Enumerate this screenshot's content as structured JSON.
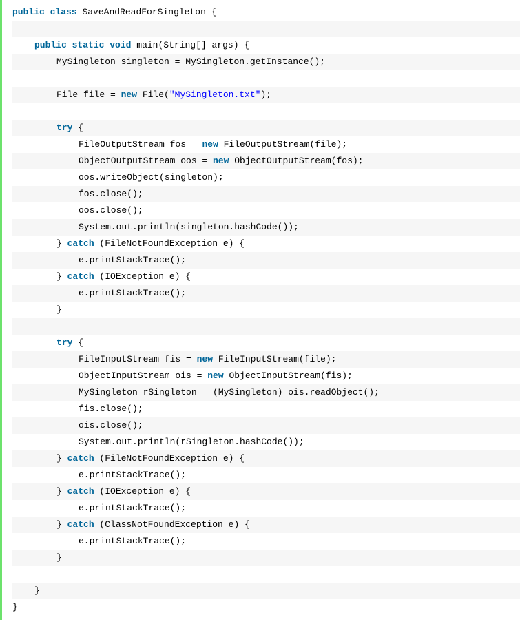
{
  "code": {
    "lines": [
      {
        "indent": 0,
        "spans": [
          {
            "t": "public",
            "c": "kw"
          },
          {
            "t": " ",
            "c": "plain"
          },
          {
            "t": "class",
            "c": "kw"
          },
          {
            "t": " SaveAndReadForSingleton {",
            "c": "plain"
          }
        ]
      },
      {
        "indent": 0,
        "spans": [
          {
            "t": " ",
            "c": "plain"
          }
        ]
      },
      {
        "indent": 1,
        "spans": [
          {
            "t": "public",
            "c": "kw"
          },
          {
            "t": " ",
            "c": "plain"
          },
          {
            "t": "static",
            "c": "kw"
          },
          {
            "t": " ",
            "c": "plain"
          },
          {
            "t": "void",
            "c": "kw"
          },
          {
            "t": " main(String[] args) {",
            "c": "plain"
          }
        ]
      },
      {
        "indent": 2,
        "spans": [
          {
            "t": "MySingleton singleton = MySingleton.getInstance();",
            "c": "plain"
          }
        ]
      },
      {
        "indent": 0,
        "spans": [
          {
            "t": " ",
            "c": "plain"
          }
        ]
      },
      {
        "indent": 2,
        "spans": [
          {
            "t": "File file = ",
            "c": "plain"
          },
          {
            "t": "new",
            "c": "kw"
          },
          {
            "t": " File(",
            "c": "plain"
          },
          {
            "t": "\"MySingleton.txt\"",
            "c": "str"
          },
          {
            "t": ");",
            "c": "plain"
          }
        ]
      },
      {
        "indent": 0,
        "spans": [
          {
            "t": " ",
            "c": "plain"
          }
        ]
      },
      {
        "indent": 2,
        "spans": [
          {
            "t": "try",
            "c": "kw"
          },
          {
            "t": " {",
            "c": "plain"
          }
        ]
      },
      {
        "indent": 3,
        "spans": [
          {
            "t": "FileOutputStream fos = ",
            "c": "plain"
          },
          {
            "t": "new",
            "c": "kw"
          },
          {
            "t": " FileOutputStream(file);",
            "c": "plain"
          }
        ]
      },
      {
        "indent": 3,
        "spans": [
          {
            "t": "ObjectOutputStream oos = ",
            "c": "plain"
          },
          {
            "t": "new",
            "c": "kw"
          },
          {
            "t": " ObjectOutputStream(fos);",
            "c": "plain"
          }
        ]
      },
      {
        "indent": 3,
        "spans": [
          {
            "t": "oos.writeObject(singleton);",
            "c": "plain"
          }
        ]
      },
      {
        "indent": 3,
        "spans": [
          {
            "t": "fos.close();",
            "c": "plain"
          }
        ]
      },
      {
        "indent": 3,
        "spans": [
          {
            "t": "oos.close();",
            "c": "plain"
          }
        ]
      },
      {
        "indent": 3,
        "spans": [
          {
            "t": "System.out.println(singleton.hashCode());",
            "c": "plain"
          }
        ]
      },
      {
        "indent": 2,
        "spans": [
          {
            "t": "} ",
            "c": "plain"
          },
          {
            "t": "catch",
            "c": "kw"
          },
          {
            "t": " (FileNotFoundException e) {",
            "c": "plain"
          }
        ]
      },
      {
        "indent": 3,
        "spans": [
          {
            "t": "e.printStackTrace();",
            "c": "plain"
          }
        ]
      },
      {
        "indent": 2,
        "spans": [
          {
            "t": "} ",
            "c": "plain"
          },
          {
            "t": "catch",
            "c": "kw"
          },
          {
            "t": " (IOException e) {",
            "c": "plain"
          }
        ]
      },
      {
        "indent": 3,
        "spans": [
          {
            "t": "e.printStackTrace();",
            "c": "plain"
          }
        ]
      },
      {
        "indent": 2,
        "spans": [
          {
            "t": "}",
            "c": "plain"
          }
        ]
      },
      {
        "indent": 0,
        "spans": [
          {
            "t": " ",
            "c": "plain"
          }
        ]
      },
      {
        "indent": 2,
        "spans": [
          {
            "t": "try",
            "c": "kw"
          },
          {
            "t": " {",
            "c": "plain"
          }
        ]
      },
      {
        "indent": 3,
        "spans": [
          {
            "t": "FileInputStream fis = ",
            "c": "plain"
          },
          {
            "t": "new",
            "c": "kw"
          },
          {
            "t": " FileInputStream(file);",
            "c": "plain"
          }
        ]
      },
      {
        "indent": 3,
        "spans": [
          {
            "t": "ObjectInputStream ois = ",
            "c": "plain"
          },
          {
            "t": "new",
            "c": "kw"
          },
          {
            "t": " ObjectInputStream(fis);",
            "c": "plain"
          }
        ]
      },
      {
        "indent": 3,
        "spans": [
          {
            "t": "MySingleton rSingleton = (MySingleton) ois.readObject();",
            "c": "plain"
          }
        ]
      },
      {
        "indent": 3,
        "spans": [
          {
            "t": "fis.close();",
            "c": "plain"
          }
        ]
      },
      {
        "indent": 3,
        "spans": [
          {
            "t": "ois.close();",
            "c": "plain"
          }
        ]
      },
      {
        "indent": 3,
        "spans": [
          {
            "t": "System.out.println(rSingleton.hashCode());",
            "c": "plain"
          }
        ]
      },
      {
        "indent": 2,
        "spans": [
          {
            "t": "} ",
            "c": "plain"
          },
          {
            "t": "catch",
            "c": "kw"
          },
          {
            "t": " (FileNotFoundException e) {",
            "c": "plain"
          }
        ]
      },
      {
        "indent": 3,
        "spans": [
          {
            "t": "e.printStackTrace();",
            "c": "plain"
          }
        ]
      },
      {
        "indent": 2,
        "spans": [
          {
            "t": "} ",
            "c": "plain"
          },
          {
            "t": "catch",
            "c": "kw"
          },
          {
            "t": " (IOException e) {",
            "c": "plain"
          }
        ]
      },
      {
        "indent": 3,
        "spans": [
          {
            "t": "e.printStackTrace();",
            "c": "plain"
          }
        ]
      },
      {
        "indent": 2,
        "spans": [
          {
            "t": "} ",
            "c": "plain"
          },
          {
            "t": "catch",
            "c": "kw"
          },
          {
            "t": " (ClassNotFoundException e) {",
            "c": "plain"
          }
        ]
      },
      {
        "indent": 3,
        "spans": [
          {
            "t": "e.printStackTrace();",
            "c": "plain"
          }
        ]
      },
      {
        "indent": 2,
        "spans": [
          {
            "t": "}",
            "c": "plain"
          }
        ]
      },
      {
        "indent": 0,
        "spans": [
          {
            "t": " ",
            "c": "plain"
          }
        ]
      },
      {
        "indent": 1,
        "spans": [
          {
            "t": "}",
            "c": "plain"
          }
        ]
      },
      {
        "indent": 0,
        "spans": [
          {
            "t": "}",
            "c": "plain"
          }
        ]
      }
    ]
  }
}
